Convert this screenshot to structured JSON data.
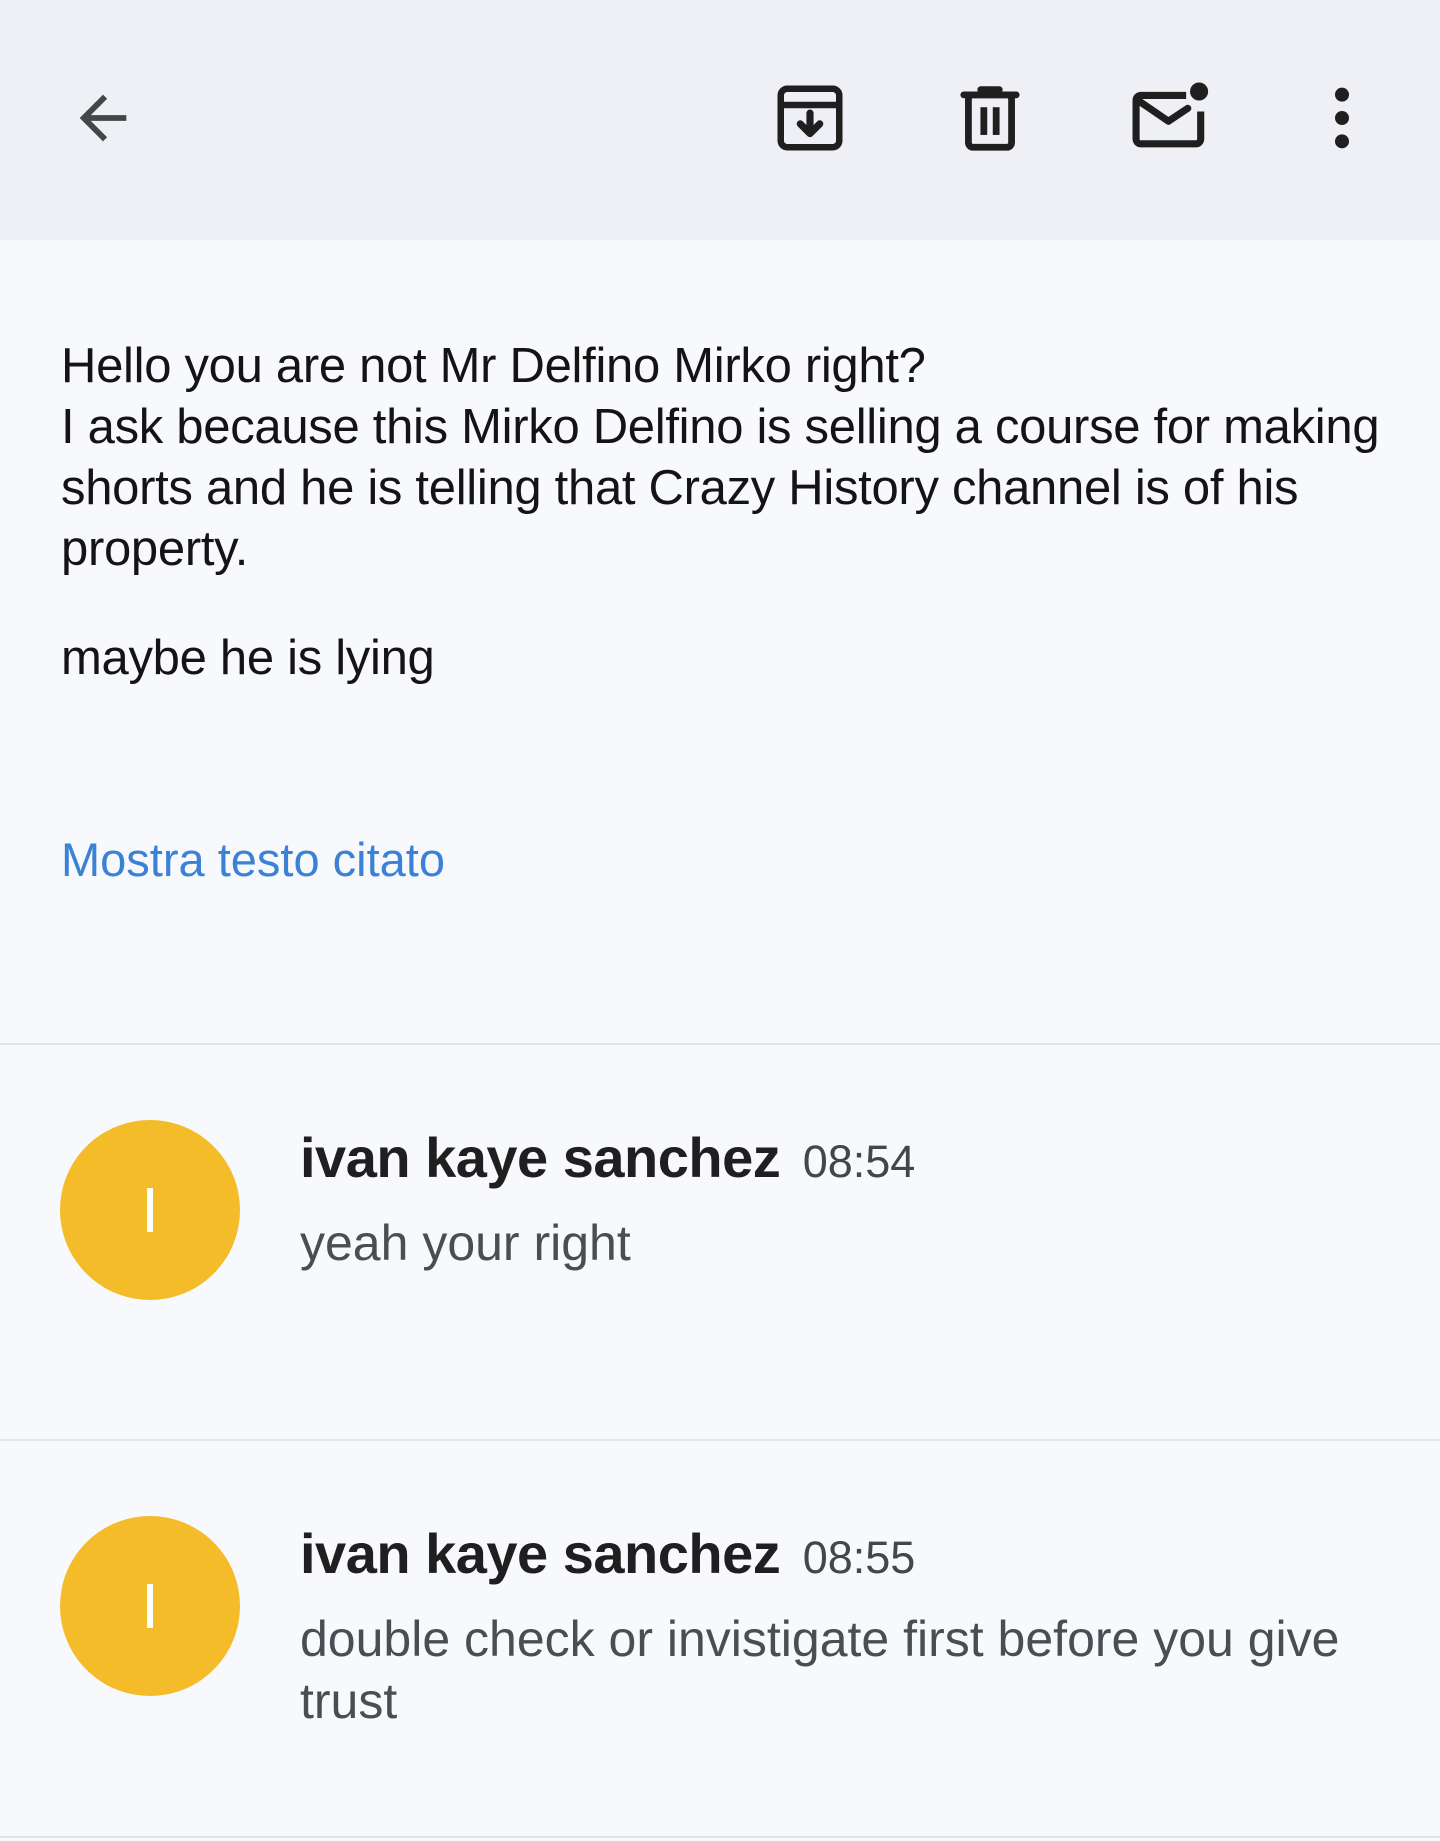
{
  "toolbar": {
    "back_icon": "arrow-back-icon",
    "archive_icon": "archive-icon",
    "delete_icon": "trash-icon",
    "mark_unread_icon": "mail-unread-icon",
    "more_icon": "more-vert-icon",
    "icon_color": "#444746"
  },
  "email": {
    "body_lines": [
      "Hello you are not Mr Delfino Mirko right?",
      "I ask because this Mirko Delfino is selling a course for making shorts and he is telling that Crazy History channel is of his property."
    ],
    "body_para2": "maybe he is lying",
    "show_quoted_label": "Mostra testo citato"
  },
  "messages": [
    {
      "avatar_letter": "I",
      "sender": "ivan kaye sanchez",
      "time": "08:54",
      "snippet": "yeah your right"
    },
    {
      "avatar_letter": "I",
      "sender": "ivan kaye sanchez",
      "time": "08:55",
      "snippet": "double check or invistigate first before you give trust"
    }
  ],
  "colors": {
    "avatar": "#f4bc28",
    "link": "#3b82d6",
    "toolbar_bg": "#eff0f5",
    "page_bg": "#f8f9fd"
  }
}
